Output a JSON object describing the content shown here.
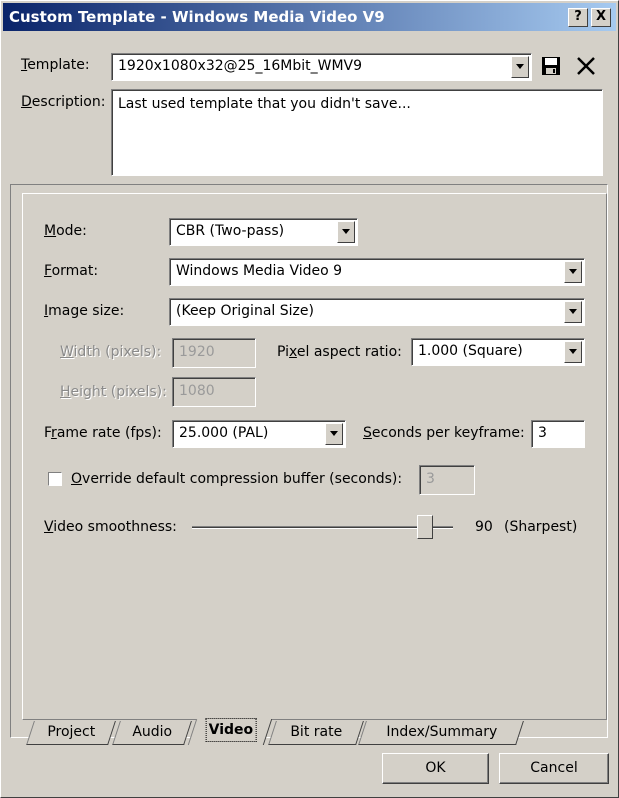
{
  "window": {
    "title": "Custom Template - Windows Media Video V9",
    "help_label": "?",
    "close_label": "X"
  },
  "template": {
    "label": "Template:",
    "value": "1920x1080x32@25_16Mbit_WMV9",
    "save_icon": "floppy-disk-icon",
    "delete_icon": "x-icon"
  },
  "description": {
    "label": "Description:",
    "value": "Last used template that you didn't save..."
  },
  "video": {
    "mode_label": "Mode:",
    "mode_value": "CBR (Two-pass)",
    "format_label": "Format:",
    "format_value": "Windows Media Video 9",
    "image_size_label": "Image size:",
    "image_size_value": "(Keep Original Size)",
    "width_label": "Width (pixels):",
    "width_value": "1920",
    "pixel_aspect_label": "Pixel aspect ratio:",
    "pixel_aspect_value": "1.000 (Square)",
    "height_label": "Height (pixels):",
    "height_value": "1080",
    "frame_rate_label": "Frame rate (fps):",
    "frame_rate_value": "25.000 (PAL)",
    "keyframe_label": "Seconds per keyframe:",
    "keyframe_value": "3",
    "override_label": "Override default compression buffer (seconds):",
    "override_checked": false,
    "override_value": "3",
    "smoothness_label": "Video smoothness:",
    "smoothness_value": "90",
    "smoothness_desc": "(Sharpest)",
    "smoothness_level": 0.9
  },
  "tabs": [
    {
      "label": "Project"
    },
    {
      "label": "Audio"
    },
    {
      "label": "Video"
    },
    {
      "label": "Bit rate"
    },
    {
      "label": "Index/Summary"
    }
  ],
  "buttons": {
    "ok": "OK",
    "cancel": "Cancel"
  }
}
